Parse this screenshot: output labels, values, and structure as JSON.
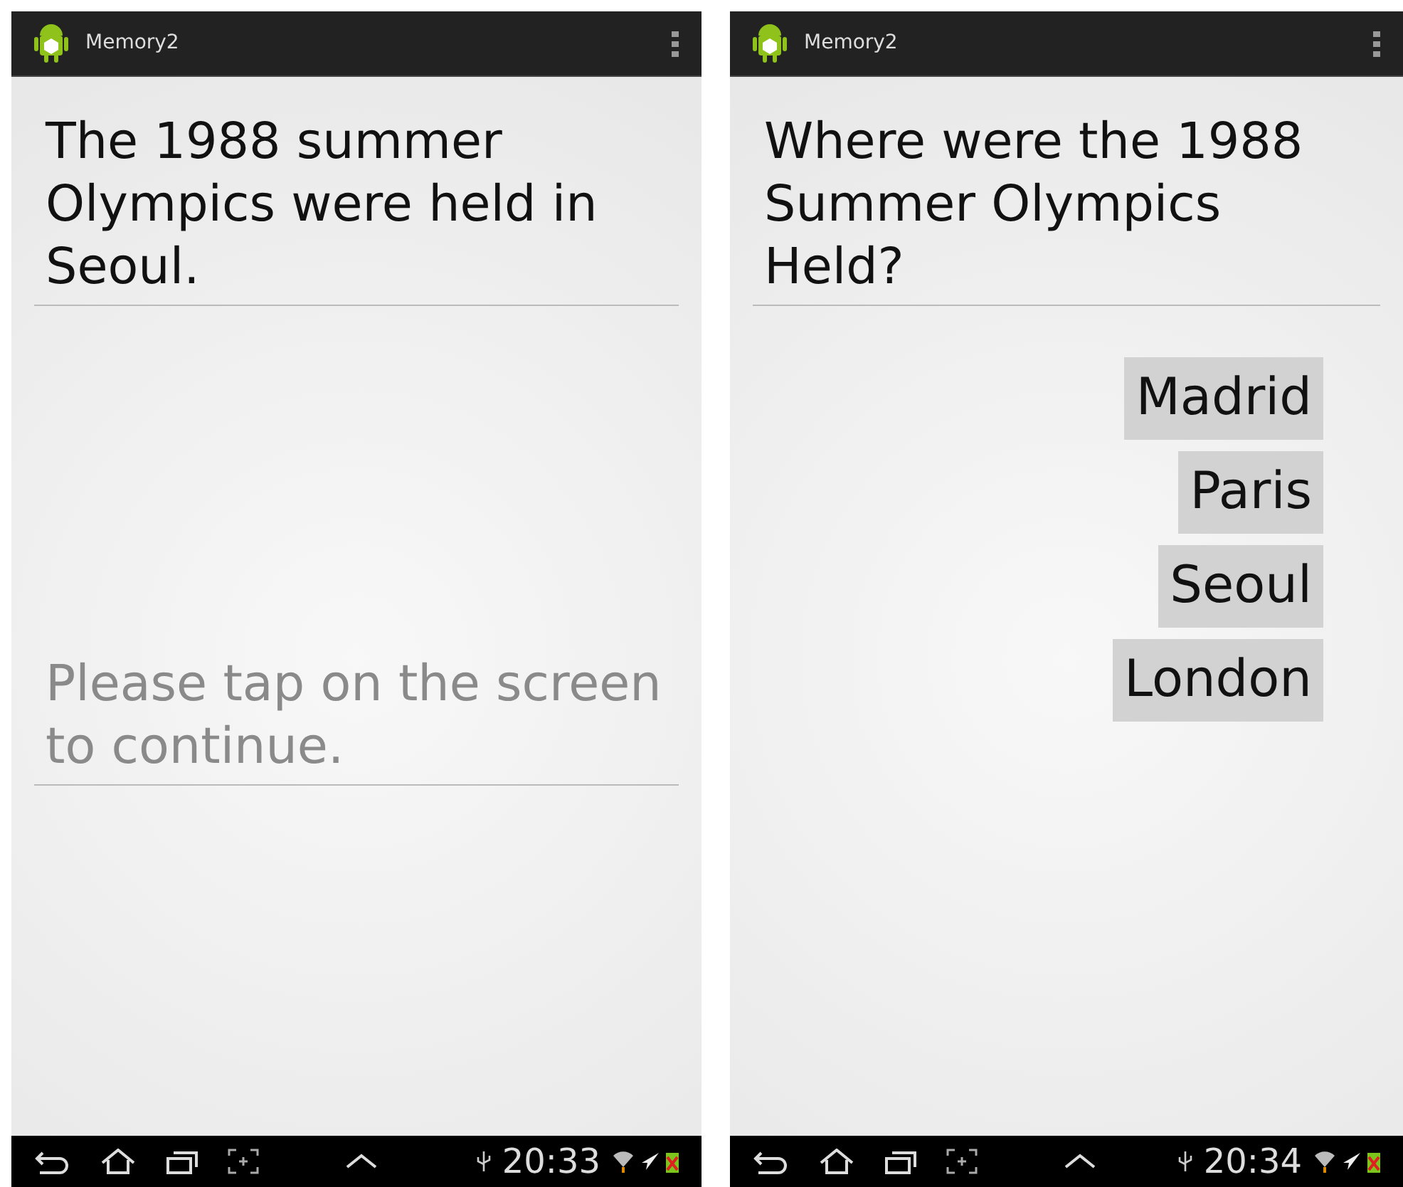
{
  "screens": [
    {
      "kind": "statement",
      "app_title": "Memory2",
      "text": "The 1988 summer Olympics were held in Seoul.",
      "prompt": "Please tap on the screen to continue.",
      "clock": "20:33"
    },
    {
      "kind": "quiz",
      "app_title": "Memory2",
      "text": "Where were the 1988 Summer Olympics Held?",
      "answers": [
        "Madrid",
        "Paris",
        "Seoul",
        "London"
      ],
      "clock": "20:34"
    }
  ]
}
